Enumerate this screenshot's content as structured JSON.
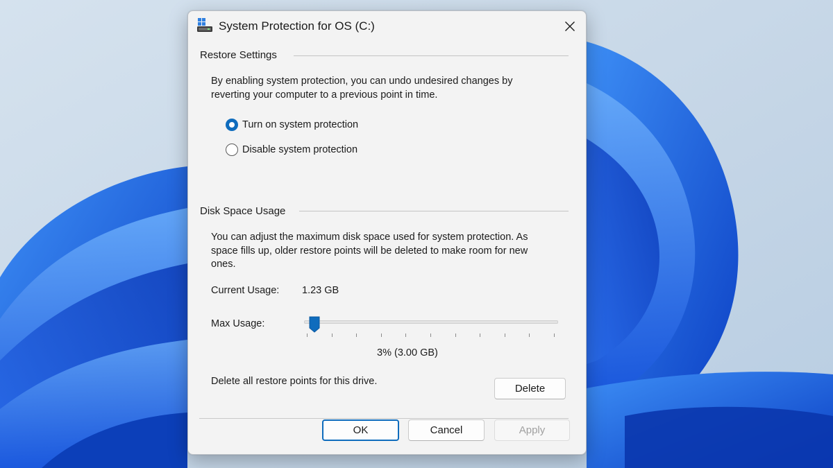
{
  "window": {
    "title": "System Protection for OS (C:)",
    "icon": "drive-protection-icon"
  },
  "restore_settings": {
    "heading": "Restore Settings",
    "description_line1": "By enabling system protection, you can undo undesired changes by",
    "description_line2": "reverting your computer to a previous point in time.",
    "options": [
      {
        "label": "Turn on system protection",
        "checked": true
      },
      {
        "label": "Disable system protection",
        "checked": false
      }
    ]
  },
  "disk_space": {
    "heading": "Disk Space Usage",
    "description_line1": "You can adjust the maximum disk space used for system protection. As",
    "description_line2": "space fills up, older restore points will be deleted to make room for new",
    "description_line3": "ones.",
    "current_usage_label": "Current Usage:",
    "current_usage_value": "1.23 GB",
    "max_usage_label": "Max Usage:",
    "max_usage_value": "3% (3.00 GB)",
    "slider_fraction": 0.02,
    "tick_count": 11,
    "delete_text": "Delete all restore points for this drive.",
    "delete_button": "Delete"
  },
  "footer": {
    "ok": "OK",
    "cancel": "Cancel",
    "apply": "Apply"
  },
  "colors": {
    "accent": "#0f6cbd",
    "dialog_bg": "#f3f3f3",
    "wallpaper_blue": "#1a5ce0"
  }
}
